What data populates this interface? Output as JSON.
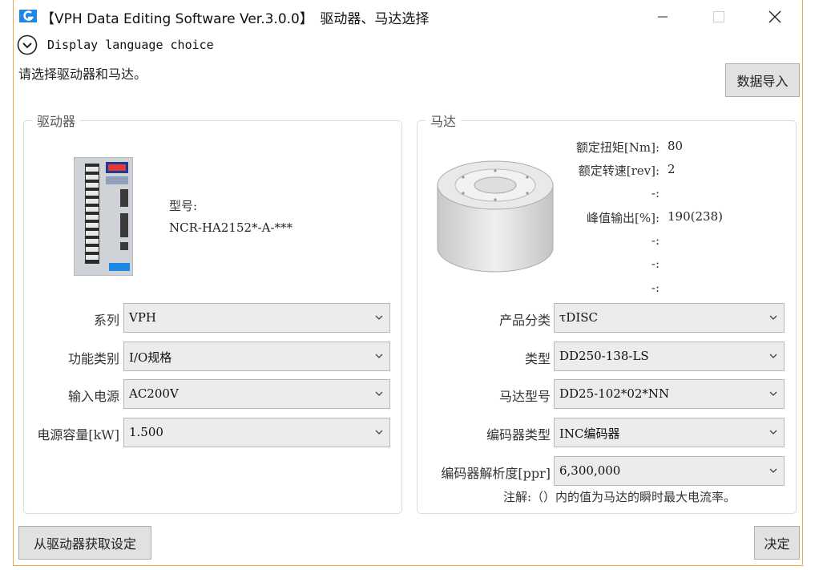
{
  "window": {
    "title": "【VPH Data Editing Software Ver.3.0.0】　驱动器、马达选择"
  },
  "language": {
    "label": "Display language choice"
  },
  "prompt": "请选择驱动器和马达。",
  "buttons": {
    "import": "数据导入",
    "from_drive": "从驱动器获取设定",
    "decide": "决定"
  },
  "driver": {
    "group_title": "驱动器",
    "model_caption": "型号:",
    "model_value": "NCR-HA2152*-A-***",
    "fields": [
      {
        "label": "系列",
        "value": "VPH"
      },
      {
        "label": "功能类别",
        "value": "I/O规格"
      },
      {
        "label": "输入电源",
        "value": "AC200V"
      },
      {
        "label": "电源容量[kW]",
        "value": "1.500"
      }
    ]
  },
  "motor": {
    "group_title": "马达",
    "specs": [
      {
        "label": "额定扭矩[Nm]:",
        "value": "80"
      },
      {
        "label": "额定转速[rev]:",
        "value": "2"
      },
      {
        "label": "-:",
        "value": ""
      },
      {
        "label": "峰值输出[%]:",
        "value": "190(238)"
      },
      {
        "label": "-:",
        "value": ""
      },
      {
        "label": "-:",
        "value": ""
      },
      {
        "label": "-:",
        "value": ""
      }
    ],
    "fields": [
      {
        "label": "产品分类",
        "value": "τDISC"
      },
      {
        "label": "类型",
        "value": "DD250-138-LS"
      },
      {
        "label": "马达型号",
        "value": "DD25-102*02*NN"
      },
      {
        "label": "编码器类型",
        "value": "INC编码器"
      },
      {
        "label": "编码器解析度[ppr]",
        "value": "6,300,000"
      }
    ],
    "note": "注解:（）内的值为马达的瞬时最大电流率。"
  },
  "colors": {
    "accent": "#1e88e5",
    "frame": "#f0a64c",
    "button_bg": "#e1e1e1"
  },
  "icons": [
    "app-icon",
    "minimize-icon",
    "maximize-icon",
    "close-icon",
    "chevron-down-icon"
  ]
}
